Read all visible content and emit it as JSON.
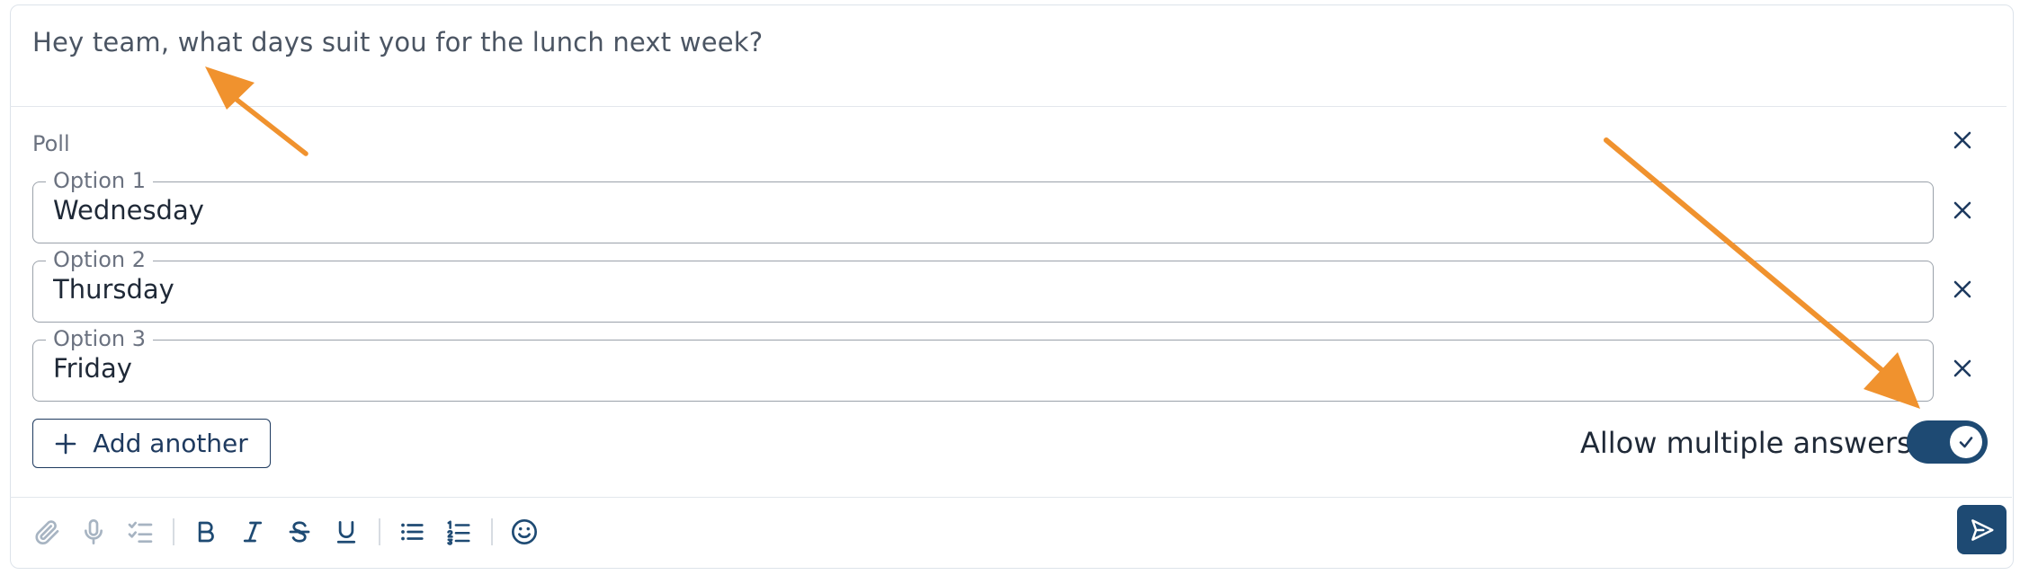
{
  "message": {
    "text": "Hey team, what days suit you for the lunch next week?"
  },
  "poll": {
    "label": "Poll",
    "options": [
      {
        "legend": "Option 1",
        "value": "Wednesday"
      },
      {
        "legend": "Option 2",
        "value": "Thursday"
      },
      {
        "legend": "Option 3",
        "value": "Friday"
      }
    ],
    "add_label": "Add another",
    "allow_multiple_label": "Allow multiple answers",
    "allow_multiple": true
  },
  "toolbar": {
    "icons": [
      "paperclip-icon",
      "microphone-icon",
      "checklist-icon",
      "bold-icon",
      "italic-icon",
      "strikethrough-icon",
      "underline-icon",
      "bullet-list-icon",
      "numbered-list-icon",
      "emoji-icon"
    ],
    "send": "send-icon"
  },
  "colors": {
    "accent": "#1e4a73",
    "annotation_arrow": "#f0922e"
  }
}
